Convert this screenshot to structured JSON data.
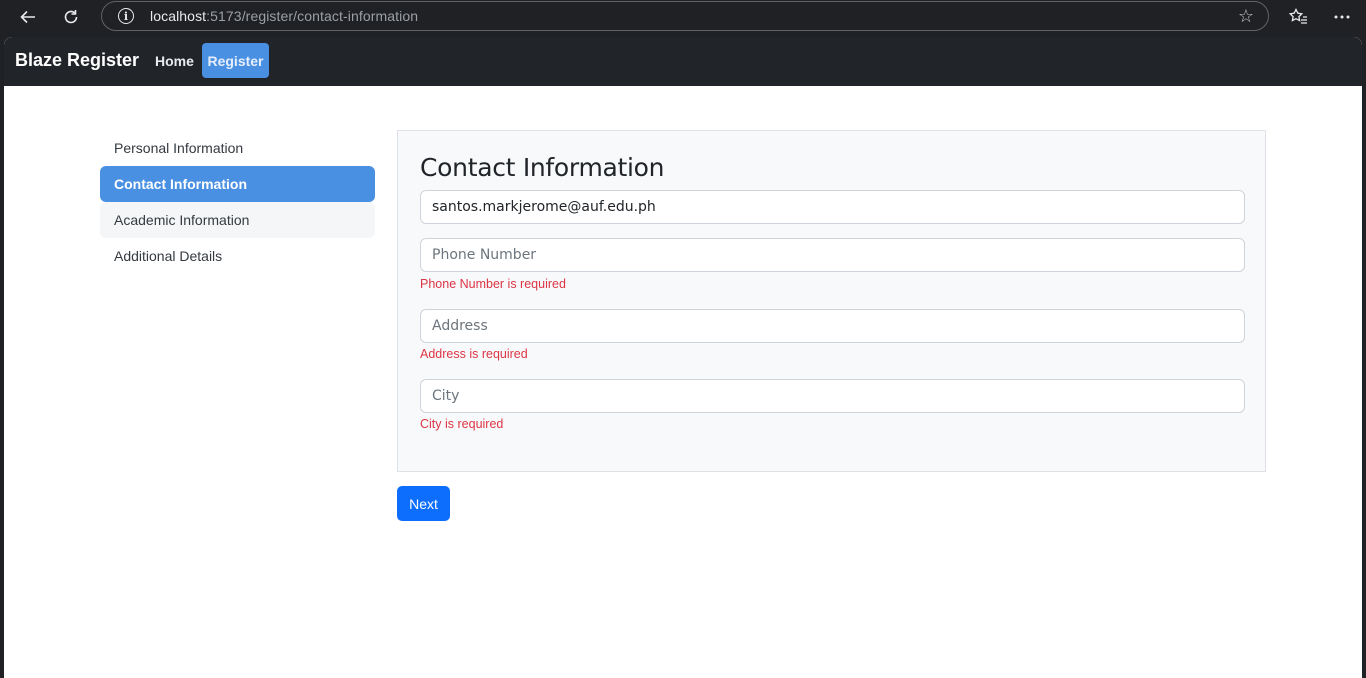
{
  "browser": {
    "url_host": "localhost",
    "url_path": ":5173/register/contact-information"
  },
  "navbar": {
    "brand": "Blaze Register",
    "links": [
      {
        "label": "Home"
      },
      {
        "label": "Register"
      }
    ]
  },
  "sidebar": {
    "items": [
      {
        "label": "Personal Information"
      },
      {
        "label": "Contact Information",
        "active": true
      },
      {
        "label": "Academic Information"
      },
      {
        "label": "Additional Details"
      }
    ]
  },
  "form": {
    "title": "Contact Information",
    "email_value": "santos.markjerome@auf.edu.ph",
    "phone_placeholder": "Phone Number",
    "phone_error": "Phone Number is required",
    "address_placeholder": "Address",
    "address_error": "Address is required",
    "city_placeholder": "City",
    "city_error": "City is required",
    "next_label": "Next"
  },
  "colors": {
    "navbar_bg": "#212529",
    "accent": "#4a90e2",
    "primary_button": "#0d6efd",
    "error": "#dc3545"
  }
}
